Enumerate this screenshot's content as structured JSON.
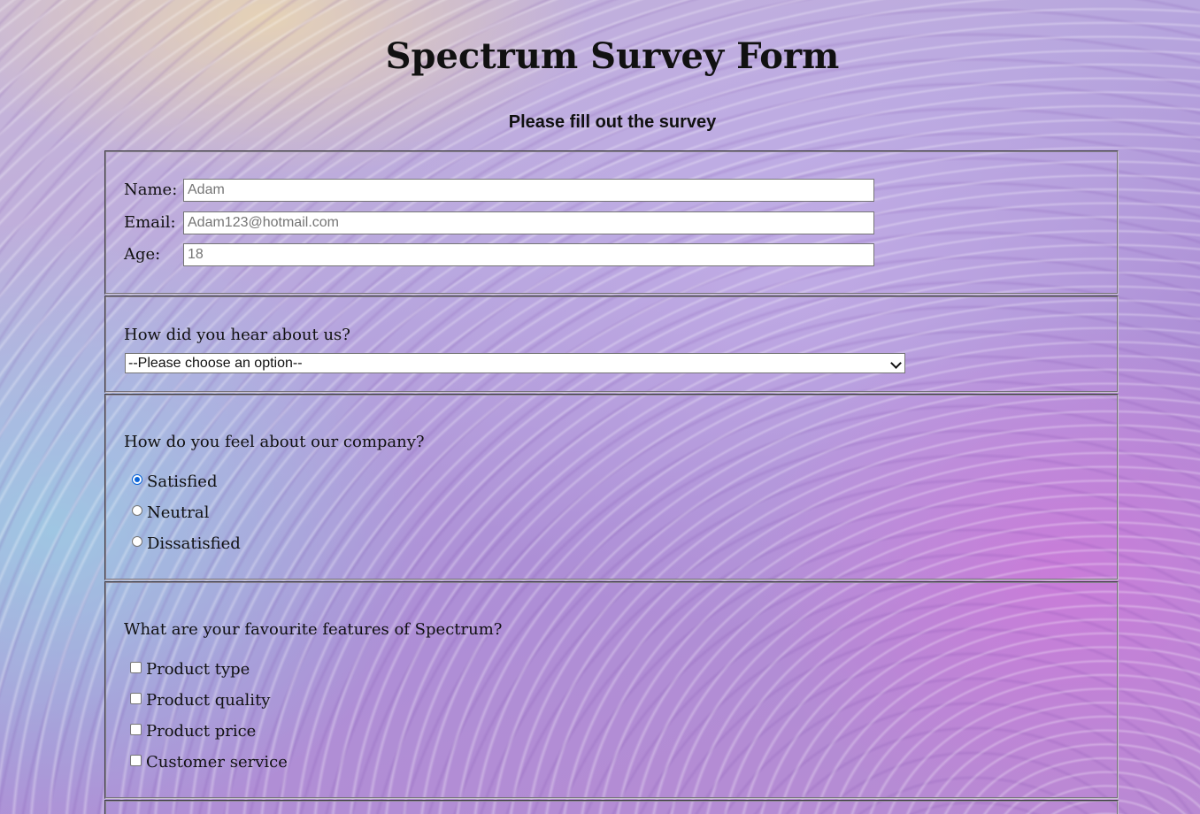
{
  "header": {
    "title": "Spectrum Survey Form",
    "subtitle": "Please fill out the survey"
  },
  "personal": {
    "name_label": "Name:",
    "name_placeholder": "Adam",
    "email_label": "Email:",
    "email_placeholder": "Adam123@hotmail.com",
    "age_label": "Age:",
    "age_placeholder": "18"
  },
  "referral": {
    "question": "How did you hear about us?",
    "selected": "--Please choose an option--"
  },
  "feeling": {
    "question": "How do you feel about our company?",
    "options": [
      "Satisfied",
      "Neutral",
      "Dissatisfied"
    ],
    "selected": "Satisfied"
  },
  "features": {
    "question": "What are your favourite features of Spectrum?",
    "options": [
      "Product type",
      "Product quality",
      "Product price",
      "Customer service"
    ]
  },
  "colors": {
    "radio_selected": "#0a64d8"
  }
}
